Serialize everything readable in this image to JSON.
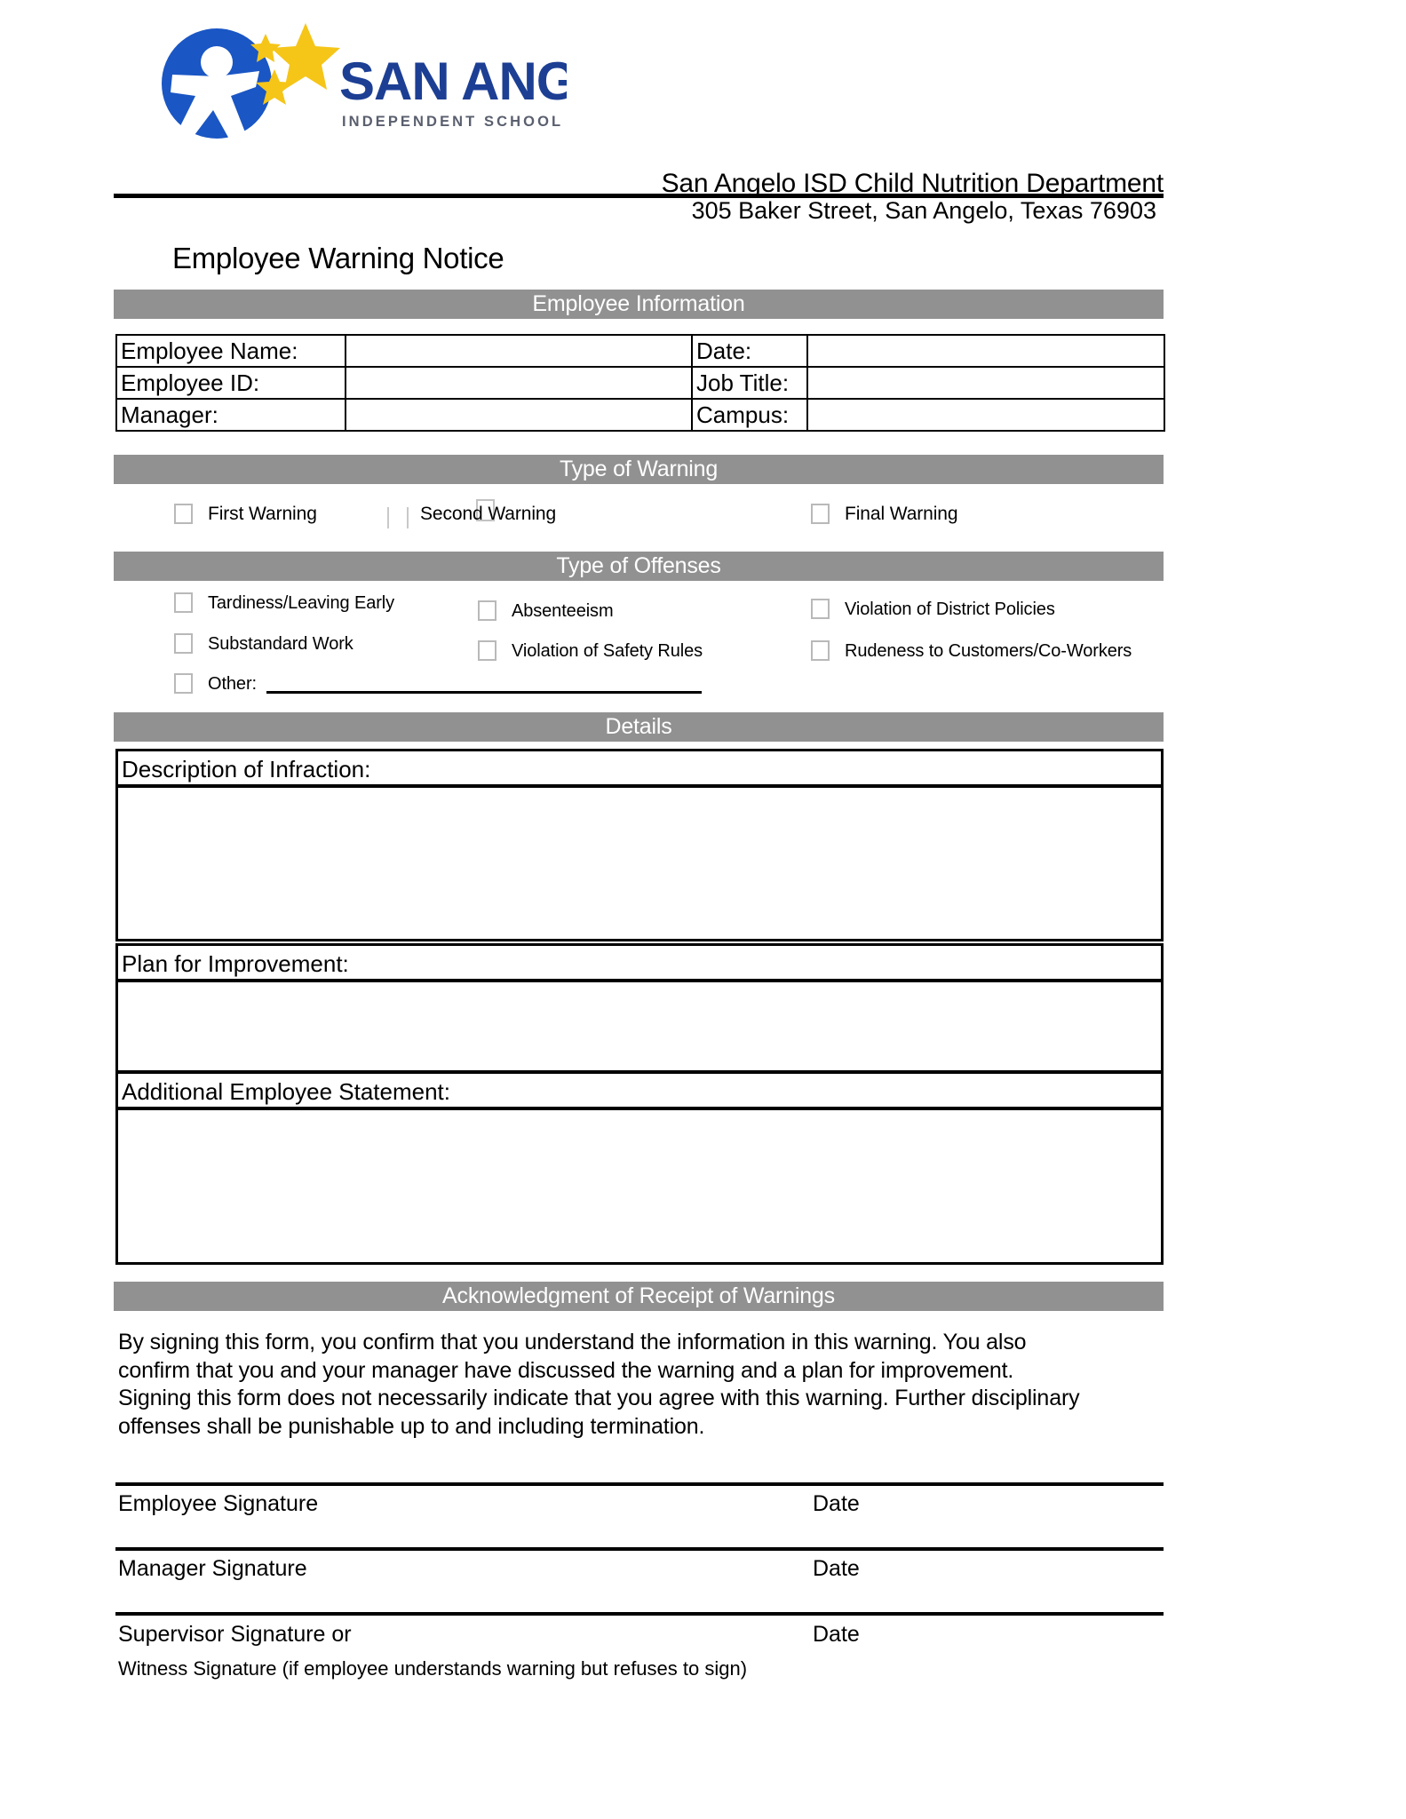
{
  "document": {
    "logo": {
      "organization": "SAN ANGELO",
      "tagline": "INDEPENDENT SCHOOL DISTRICT",
      "icon_name": "san-angelo-isd-star-person-logo",
      "colors": {
        "blue": "#1a56c4",
        "navy": "#1c3f94",
        "gold": "#f5c518",
        "tagline_gray": "#5a5f6e"
      }
    },
    "header": {
      "department": "San Angelo ISD Child Nutrition Department",
      "address": "305 Baker Street, San Angelo, Texas 76903"
    },
    "title": "Employee Warning Notice",
    "colors": {
      "section_bar": "#919191",
      "section_bar_text": "#ffffff",
      "rule": "#000000",
      "checkbox_border": "#b9b9b9"
    }
  },
  "sections": {
    "employee_information": {
      "heading": "Employee Information",
      "rows": [
        {
          "left_label": "Employee Name:",
          "left_value": "",
          "right_label": "Date:",
          "right_value": ""
        },
        {
          "left_label": "Employee ID:",
          "left_value": "",
          "right_label": "Job Title:",
          "right_value": ""
        },
        {
          "left_label": "Manager:",
          "left_value": "",
          "right_label": "Campus:",
          "right_value": ""
        }
      ]
    },
    "type_of_warning": {
      "heading": "Type of Warning",
      "options": [
        {
          "label": "First Warning",
          "checked": false
        },
        {
          "label": "Second Warning",
          "checked": false
        },
        {
          "label": "Final Warning",
          "checked": false
        }
      ]
    },
    "type_of_offenses": {
      "heading": "Type of Offenses",
      "options": [
        {
          "label": "Tardiness/Leaving Early",
          "checked": false
        },
        {
          "label": "Absenteeism",
          "checked": false
        },
        {
          "label": "Violation of District Policies",
          "checked": false
        },
        {
          "label": "Substandard Work",
          "checked": false
        },
        {
          "label": "Violation of Safety Rules",
          "checked": false
        },
        {
          "label": "Rudeness to Customers/Co-Workers",
          "checked": false
        }
      ],
      "other": {
        "label": "Other:",
        "value": "",
        "checked": false
      }
    },
    "details": {
      "heading": "Details",
      "fields": [
        {
          "label": "Description of Infraction:",
          "value": ""
        },
        {
          "label": "Plan for Improvement:",
          "value": ""
        },
        {
          "label": "Additional Employee Statement:",
          "value": ""
        }
      ]
    },
    "acknowledgment": {
      "heading": "Acknowledgment of Receipt of Warnings",
      "paragraph": "By signing this form, you confirm that you understand the information in this warning. You also confirm that you and your manager have discussed the warning and a plan for improvement. Signing this form does not necessarily indicate that you agree with this warning. Further disciplinary offenses shall be punishable up to and including termination.",
      "signatures": [
        {
          "label": "Employee Signature",
          "date_label": "Date",
          "sub_label": ""
        },
        {
          "label": "Manager Signature",
          "date_label": "Date",
          "sub_label": ""
        },
        {
          "label": "Supervisor Signature or",
          "date_label": "Date",
          "sub_label": "Witness Signature (if employee understands warning but refuses to sign)"
        }
      ]
    }
  }
}
